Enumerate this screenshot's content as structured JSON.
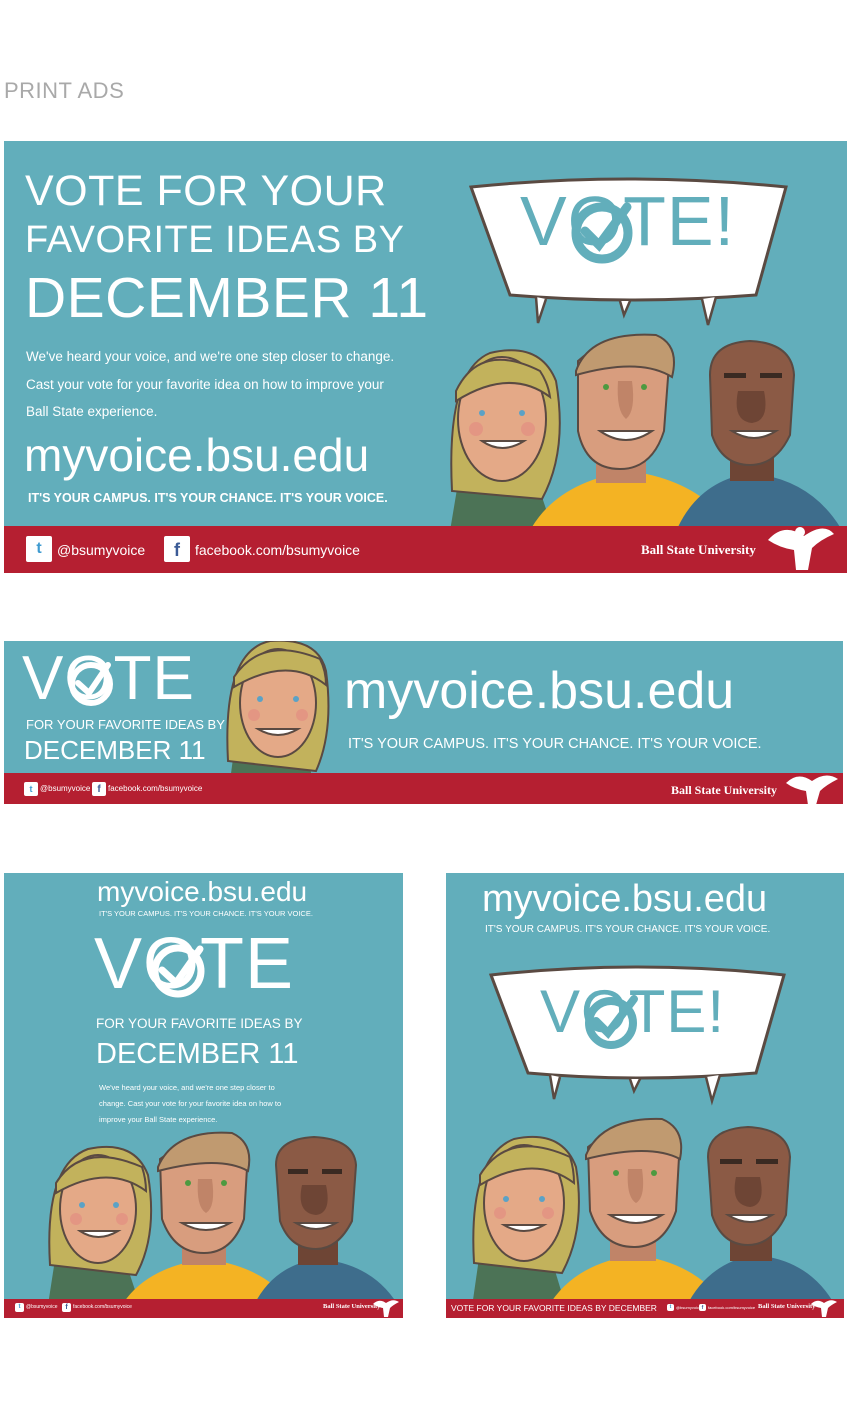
{
  "section_title": "PRINT ADS",
  "colors": {
    "teal": "#62aebb",
    "red": "#b51f31",
    "white": "#ffffff",
    "skin_light": "#e4a987",
    "skin_mid": "#d89d7e",
    "skin_dark": "#8b5a45",
    "hair_blonde": "#c2b25c",
    "shirt_yellow": "#f4b323",
    "shirt_green": "#4c7356",
    "shirt_blue": "#3e6d8c"
  },
  "icons": [
    "twitter-icon",
    "facebook-icon",
    "ball-state-cardinal-logo",
    "vote-speech-bubble",
    "checkmark-icon"
  ],
  "ad1": {
    "headline_1": "VOTE FOR YOUR",
    "headline_2": "FAVORITE IDEAS BY",
    "headline_3": "DECEMBER 11",
    "body_1": "We've heard your voice, and we're one step closer to change.",
    "body_2": "Cast your vote for your favorite idea on how to improve your",
    "body_3": "Ball State experience.",
    "url": "myvoice.bsu.edu",
    "tagline": "IT'S YOUR CAMPUS.  IT'S YOUR CHANCE.  IT'S YOUR VOICE.",
    "bubble_text": "VOTE!",
    "twitter": "@bsumyvoice",
    "facebook": "facebook.com/bsumyvoice",
    "university": "Ball State University"
  },
  "ad2": {
    "vote": "VOTE",
    "sub": "FOR YOUR FAVORITE IDEAS BY",
    "date": "DECEMBER 11",
    "url": "myvoice.bsu.edu",
    "tagline": "IT'S YOUR CAMPUS.  IT'S YOUR CHANCE.  IT'S YOUR VOICE.",
    "twitter": "@bsumyvoice",
    "facebook": "facebook.com/bsumyvoice",
    "university": "Ball State University"
  },
  "ad3": {
    "url": "myvoice.bsu.edu",
    "tagline": "IT'S YOUR CAMPUS.  IT'S YOUR CHANCE.  IT'S YOUR VOICE.",
    "vote": "VOTE",
    "sub": "FOR YOUR FAVORITE IDEAS BY",
    "date": "DECEMBER 11",
    "body_1": "We've heard your voice, and we're one step closer to",
    "body_2": "change. Cast your vote for your favorite idea on how to",
    "body_3": "improve your Ball State experience.",
    "twitter": "@bsumyvoice",
    "facebook": "facebook.com/bsumyvoice",
    "university": "Ball State University"
  },
  "ad4": {
    "url": "myvoice.bsu.edu",
    "tagline": "IT'S YOUR CAMPUS.  IT'S YOUR CHANCE.  IT'S YOUR VOICE.",
    "bubble_text": "VOTE!",
    "footer_text": "VOTE FOR YOUR FAVORITE IDEAS BY DECEMBER",
    "twitter": "@bsumyvoice",
    "facebook": "facebook.com/bsumyvoice",
    "university": "Ball State University"
  }
}
